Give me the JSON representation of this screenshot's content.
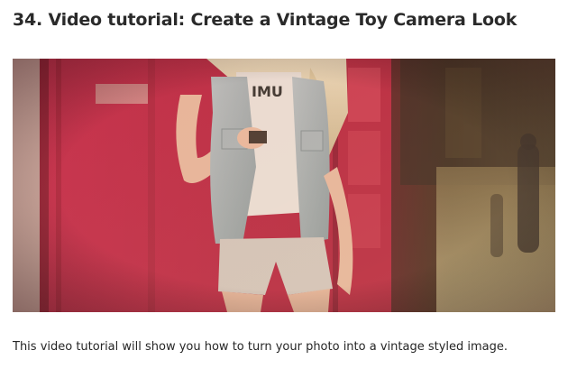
{
  "article": {
    "title": "34. Video tutorial: Create a Vintage Toy Camera Look",
    "image_alt": "Vintage toy camera styled photo of a woman in a denim vest leaning against a red phone box",
    "description": "This video tutorial will show you how to turn your photo into a vintage styled image."
  },
  "colors": {
    "heading": "#2a2a2a",
    "body_text": "#262626",
    "photo_red": "#b3203f",
    "photo_dark": "#3a2a1c"
  }
}
